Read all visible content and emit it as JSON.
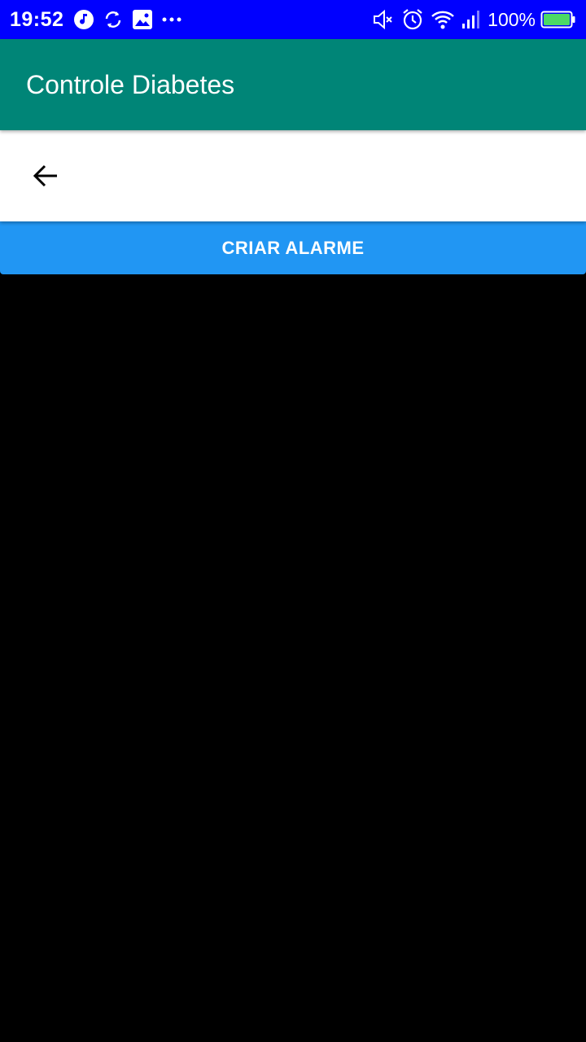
{
  "status_bar": {
    "time": "19:52",
    "battery_percent": "100%",
    "left_icons": [
      "music-note-icon",
      "sync-icon",
      "gallery-icon",
      "more-dots-icon"
    ],
    "right_icons": [
      "mute-icon",
      "alarm-clock-icon",
      "wifi-icon",
      "signal-icon",
      "battery-icon"
    ],
    "background_color": "#0000ff",
    "battery_color": "#4cd964"
  },
  "app_bar": {
    "title": "Controle Diabetes",
    "background_color": "#008577"
  },
  "sub_toolbar": {
    "back_icon": "arrow-back-icon"
  },
  "create_alarm_button": {
    "label": "CRIAR ALARME",
    "background_color": "#2196f3"
  }
}
